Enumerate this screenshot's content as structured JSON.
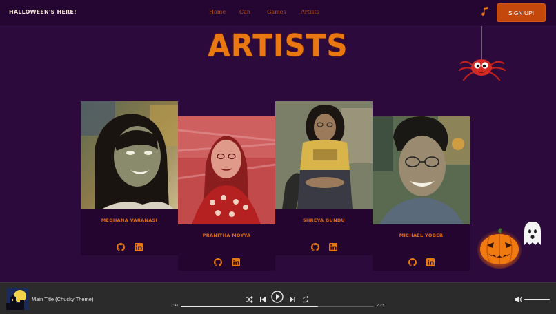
{
  "navbar": {
    "brand": "HALLOWEEN'S HERE!",
    "links": [
      "Home",
      "Can",
      "Games",
      "Artists"
    ],
    "music_icon": "music-note-icon",
    "signup_label": "SIGN UP!"
  },
  "page": {
    "title": "ARTISTS"
  },
  "artists": [
    {
      "name": "MEGHANA VARANASI",
      "icons": [
        "github-icon",
        "linkedin-icon"
      ]
    },
    {
      "name": "PRANITHA MOYYA",
      "icons": [
        "github-icon",
        "linkedin-icon"
      ]
    },
    {
      "name": "SHREYA GUNDU",
      "icons": [
        "github-icon",
        "linkedin-icon"
      ]
    },
    {
      "name": "MICHAEL YOGER",
      "icons": [
        "github-icon",
        "linkedin-icon"
      ]
    }
  ],
  "decor": [
    "spider-icon",
    "pumpkin-icon",
    "ghost-icon"
  ],
  "player": {
    "track_title": "Main Title (Chucky Theme)",
    "elapsed": "1:41",
    "duration": "2:23",
    "progress_fraction": 0.71,
    "volume_fraction": 1.0,
    "controls": [
      "shuffle-icon",
      "previous-icon",
      "play-icon",
      "next-icon",
      "repeat-icon"
    ],
    "volume_icon": "volume-icon"
  },
  "colors": {
    "background": "#2d0a3c",
    "navbar": "#250633",
    "accent_orange": "#e8780f",
    "signup_button": "#c4470b",
    "card": "#240530",
    "player": "#2b2b2b"
  }
}
